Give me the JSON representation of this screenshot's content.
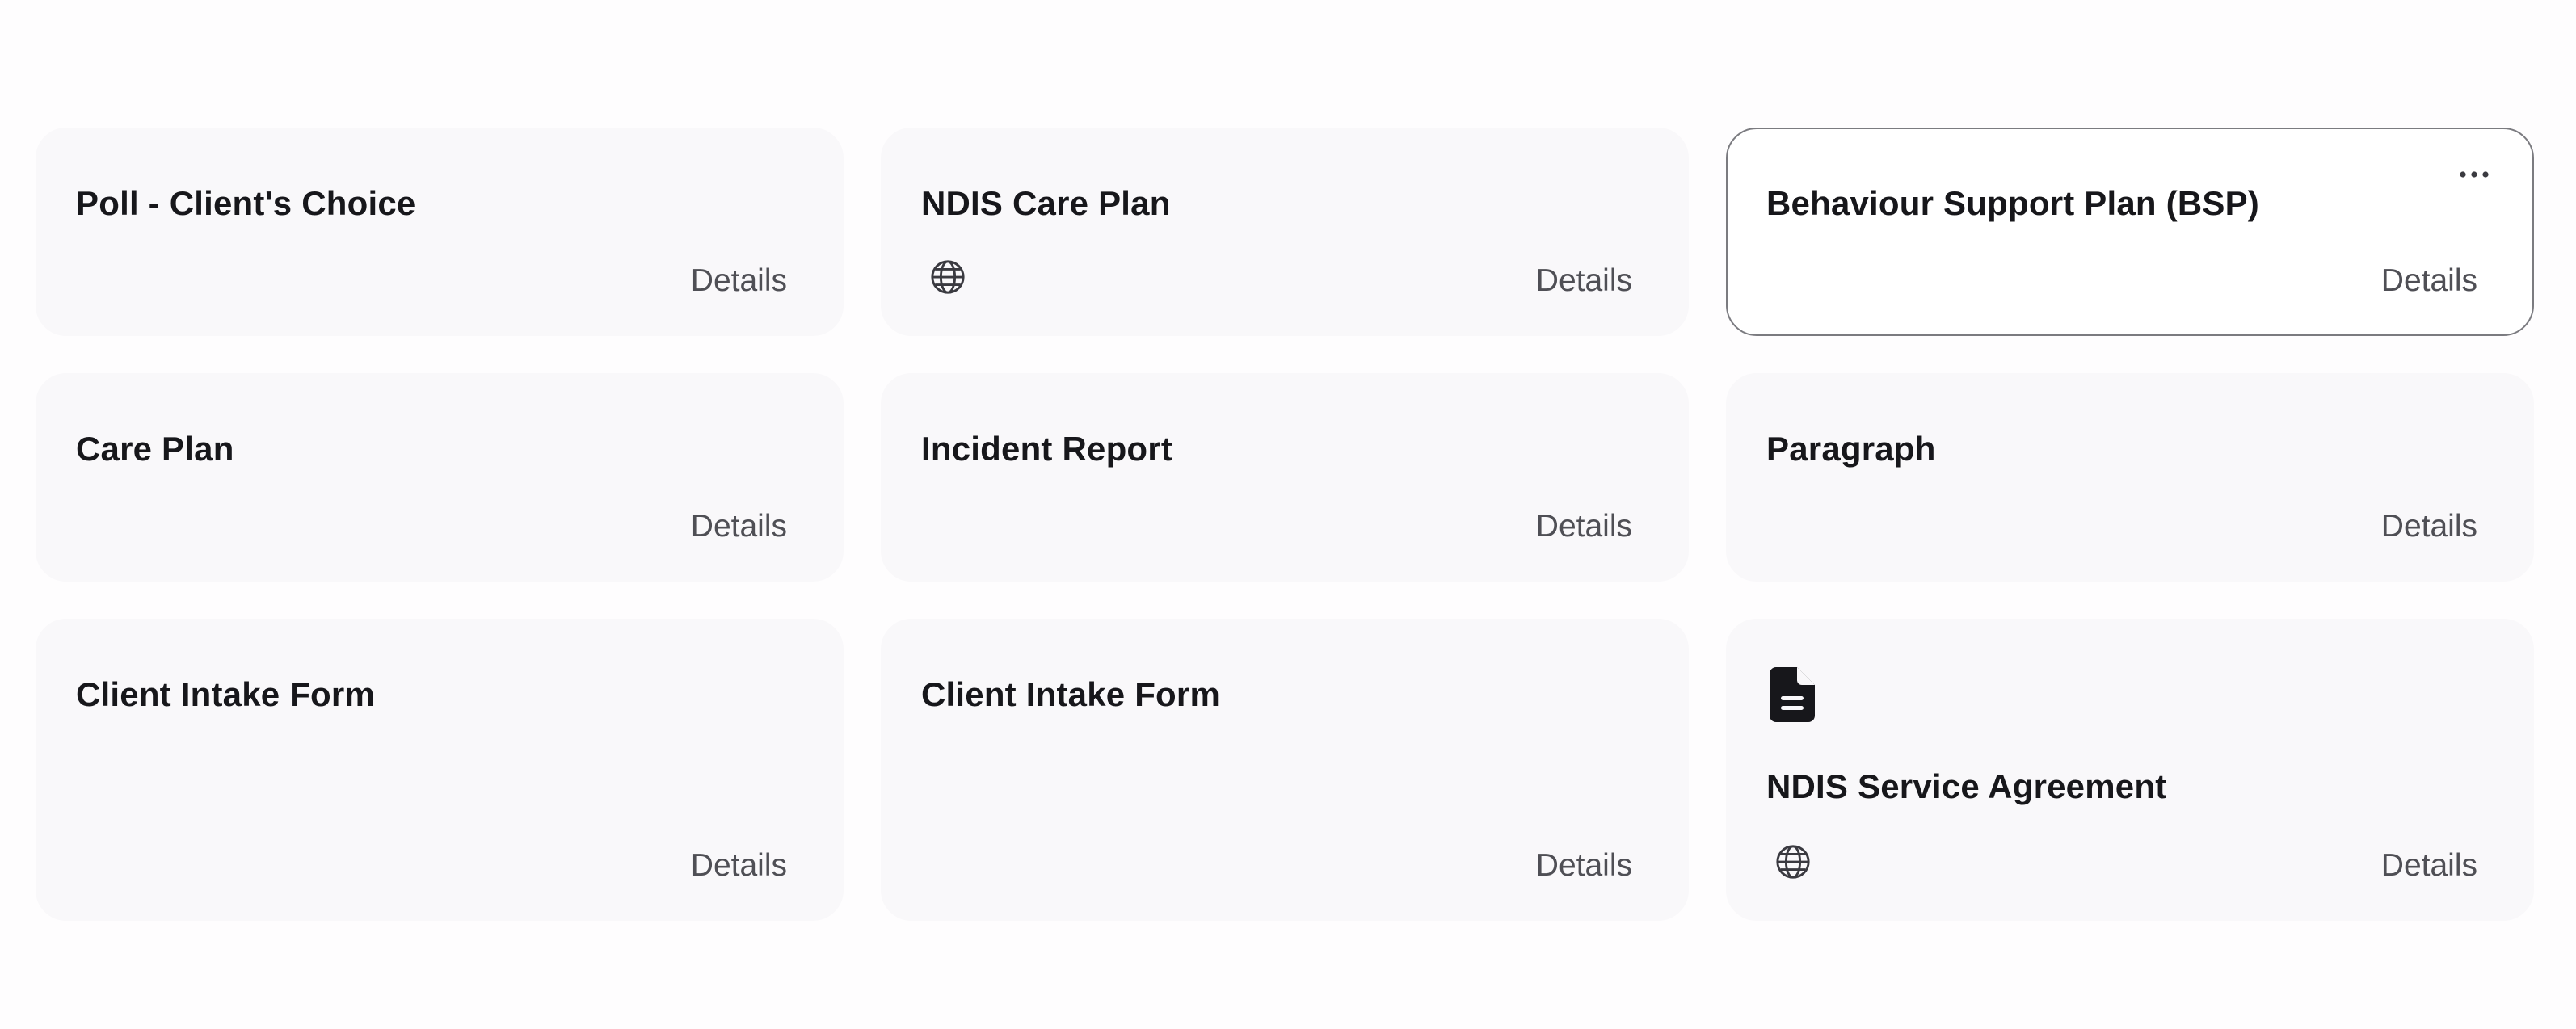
{
  "details_label": "Details",
  "cards": [
    {
      "title": "Poll - Client's Choice",
      "globe": false,
      "selected": false
    },
    {
      "title": "NDIS Care Plan",
      "globe": true,
      "selected": false
    },
    {
      "title": "Behaviour Support Plan (BSP)",
      "globe": false,
      "selected": true,
      "more_menu": true
    },
    {
      "title": "Care Plan",
      "globe": false,
      "selected": false
    },
    {
      "title": "Incident Report",
      "globe": false,
      "selected": false
    },
    {
      "title": "Paragraph",
      "globe": false,
      "selected": false
    },
    {
      "title": "Client Intake Form",
      "globe": false,
      "selected": false
    },
    {
      "title": "Client Intake Form",
      "globe": false,
      "selected": false
    },
    {
      "title": "NDIS Service Agreement",
      "globe": true,
      "selected": false,
      "document_icon": true
    }
  ],
  "icons": {
    "globe": "globe-icon",
    "more": "more-horizontal-icon",
    "document": "document-icon"
  },
  "colors": {
    "card_background": "#f9f8fa",
    "selected_border": "#7b7b80",
    "title_text": "#17171b",
    "details_text": "#4f4f55"
  }
}
